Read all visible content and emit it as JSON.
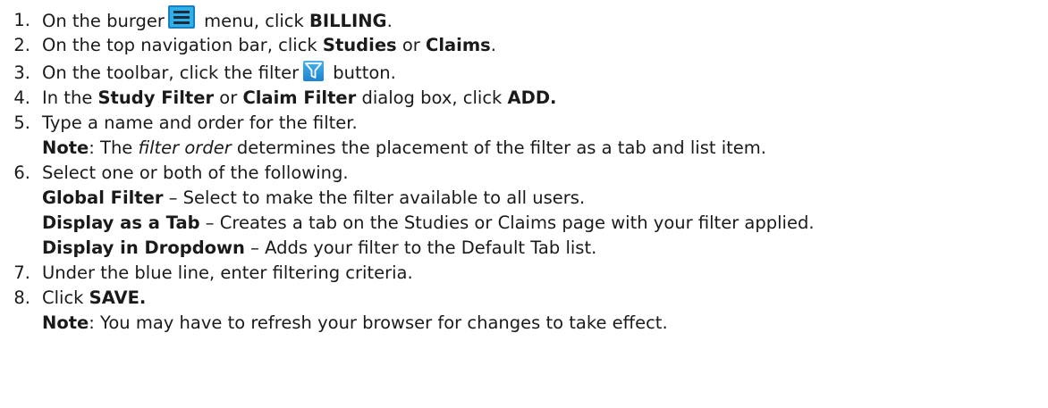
{
  "steps": [
    {
      "num": "1.",
      "pre": "On the burger",
      "icon": "burger-menu-icon",
      "mid": " menu, click ",
      "bold": "BILLING",
      "post": "."
    },
    {
      "num": "2.",
      "pre": "On the top navigation bar, click ",
      "bold1": "Studies",
      "mid": " or ",
      "bold2": "Claims",
      "post": "."
    },
    {
      "num": "3.",
      "pre": "On the toolbar, click the filter",
      "icon": "filter-icon",
      "post": " button."
    },
    {
      "num": "4.",
      "pre": "In the ",
      "bold1": "Study Filter",
      "mid1": " or ",
      "bold2": "Claim Filter",
      "mid2": " dialog box, click ",
      "bold3": "ADD."
    },
    {
      "num": "5.",
      "text": "Type a name and order for the filter.",
      "note_label": "Note",
      "note_pre": ": The ",
      "note_italic": "filter order",
      "note_post": " determines the placement of the filter as a tab and list item."
    },
    {
      "num": "6.",
      "text": "Select one or both of the following.",
      "options": [
        {
          "term": "Global Filter",
          "desc": " – Select to make the filter available to all users."
        },
        {
          "term": "Display as a Tab",
          "desc": " – Creates a tab on the Studies or Claims page with your filter applied."
        },
        {
          "term": "Display in Dropdown",
          "desc": " – Adds your filter to the Default Tab list."
        }
      ]
    },
    {
      "num": "7.",
      "text": "Under the blue line, enter filtering criteria."
    },
    {
      "num": "8.",
      "pre": "Click ",
      "bold": "SAVE.",
      "note_label": "Note",
      "note_text": ": You may have to refresh your browser for changes to take effect."
    }
  ],
  "colors": {
    "icon_blue": "#2fb0e8",
    "text": "#1a1a1a"
  }
}
